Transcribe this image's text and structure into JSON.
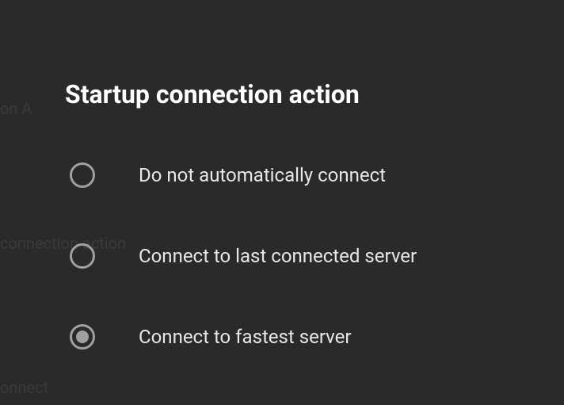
{
  "dialog": {
    "title": "Startup connection action",
    "options": [
      {
        "label": "Do not automatically connect",
        "selected": false
      },
      {
        "label": "Connect to last connected server",
        "selected": false
      },
      {
        "label": "Connect to fastest server",
        "selected": true
      }
    ]
  },
  "bg_artifacts": {
    "a1": "",
    "a2": "on A",
    "a3": "connection action",
    "a4": "onnect"
  }
}
